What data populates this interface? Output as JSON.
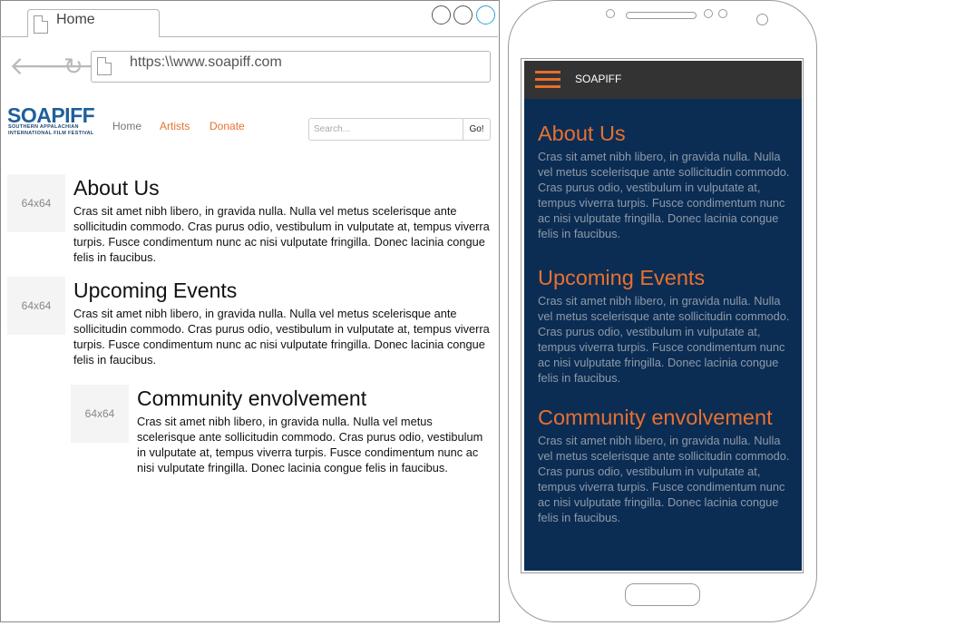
{
  "browser": {
    "tab_title": "Home",
    "url": "https:\\\\www.soapiff.com",
    "nav_icons": [
      "back-arrow-icon",
      "forward-arrow-icon",
      "reload-icon"
    ]
  },
  "site": {
    "logo": {
      "name": "SOAPIFF",
      "line1": "SOUTHERN APPALACHIAN",
      "line2": "INTERNATIONAL FILM FESTIVAL"
    },
    "nav": [
      {
        "label": "Home",
        "color": "#777777"
      },
      {
        "label": "Artists",
        "color": "#e8702f"
      },
      {
        "label": "Donate",
        "color": "#e8702f"
      }
    ],
    "search": {
      "placeholder": "Search...",
      "button": "Go!"
    },
    "sections": [
      {
        "thumb": "64x64",
        "title": "About Us",
        "body": "Cras sit amet nibh libero, in gravida nulla. Nulla vel metus scelerisque ante sollicitudin commodo. Cras purus odio, vestibulum in vulputate at, tempus viverra turpis. Fusce condimentum nunc ac nisi vulputate fringilla. Donec lacinia congue felis in faucibus."
      },
      {
        "thumb": "64x64",
        "title": "Upcoming Events",
        "body": "Cras sit amet nibh libero, in gravida nulla. Nulla vel metus scelerisque ante sollicitudin commodo. Cras purus odio, vestibulum in vulputate at, tempus viverra turpis. Fusce condimentum nunc ac nisi vulputate fringilla. Donec lacinia congue felis in faucibus."
      },
      {
        "thumb": "64x64",
        "title": "Community envolvement",
        "body": "Cras sit amet nibh libero, in gravida nulla. Nulla vel metus scelerisque ante sollicitudin commodo. Cras purus odio, vestibulum in vulputate at, tempus viverra turpis. Fusce condimentum nunc ac nisi vulputate fringilla. Donec lacinia congue felis in faucibus."
      }
    ]
  },
  "mobile": {
    "brand": "SOAPIFF",
    "menu_icon": "hamburger-menu-icon",
    "sections": [
      {
        "title": "About Us",
        "body": "Cras sit amet nibh libero, in gravida nulla. Nulla vel metus scelerisque ante sollicitudin commodo. Cras purus odio, vestibulum in vulputate at, tempus viverra turpis. Fusce condimentum nunc ac nisi vulputate fringilla. Donec lacinia congue felis in faucibus."
      },
      {
        "title": "Upcoming Events",
        "body": "Cras sit amet nibh libero, in gravida nulla. Nulla vel metus scelerisque ante sollicitudin commodo. Cras purus odio, vestibulum in vulputate at, tempus viverra turpis. Fusce condimentum nunc ac nisi vulputate fringilla. Donec lacinia congue felis in faucibus."
      },
      {
        "title": "Community envolvement",
        "body": "Cras sit amet nibh libero, in gravida nulla. Nulla vel metus scelerisque ante sollicitudin commodo. Cras purus odio, vestibulum in vulputate at, tempus viverra turpis. Fusce condimentum nunc ac nisi vulputate fringilla. Donec lacinia congue felis in faucibus."
      }
    ]
  },
  "colors": {
    "accent": "#e8702f",
    "logo_blue": "#1f5f9b",
    "mobile_header": "#333333",
    "mobile_content": "#0b2d54"
  }
}
